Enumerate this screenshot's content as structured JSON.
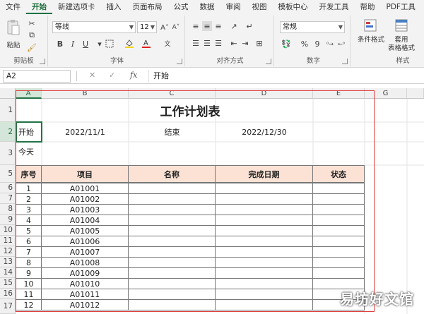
{
  "ribbon_tabs": [
    "文件",
    "开始",
    "新建选项卡",
    "插入",
    "页面布局",
    "公式",
    "数据",
    "审阅",
    "视图",
    "模板中心",
    "开发工具",
    "帮助",
    "PDF工具"
  ],
  "ribbon": {
    "clipboard_label": "剪贴板",
    "paste_label": "粘贴",
    "font_label": "字体",
    "font_name": "等线",
    "font_size": "12",
    "bold": "B",
    "italic": "I",
    "underline": "U",
    "align_label": "对齐方式",
    "number_label": "数字",
    "number_format": "常规",
    "percent": "%",
    "comma": "9",
    "styles_label": "样式",
    "cond_format": "条件格式",
    "table_format_1": "套用",
    "table_format_2": "表格格式"
  },
  "formula_bar": {
    "name_box": "A2",
    "fx": "fx",
    "cancel": "✕",
    "enter": "✓",
    "content": "开始"
  },
  "columns": [
    "A",
    "B",
    "C",
    "D",
    "E",
    "G"
  ],
  "rows": [
    "1",
    "2",
    "3",
    "5",
    "6",
    "7",
    "8",
    "9",
    "10",
    "11",
    "12",
    "13",
    "14",
    "15",
    "16",
    "17"
  ],
  "sheet": {
    "title": "工作计划表",
    "start_label": "开始",
    "start_date": "2022/11/1",
    "end_label": "结束",
    "end_date": "2022/12/30",
    "today_label": "今天",
    "headers": [
      "序号",
      "项目",
      "名称",
      "完成日期",
      "状态"
    ],
    "items": [
      {
        "no": "1",
        "code": "A01001"
      },
      {
        "no": "2",
        "code": "A01002"
      },
      {
        "no": "3",
        "code": "A01003"
      },
      {
        "no": "4",
        "code": "A01004"
      },
      {
        "no": "5",
        "code": "A01005"
      },
      {
        "no": "6",
        "code": "A01006"
      },
      {
        "no": "7",
        "code": "A01007"
      },
      {
        "no": "8",
        "code": "A01008"
      },
      {
        "no": "9",
        "code": "A01009"
      },
      {
        "no": "10",
        "code": "A01010"
      },
      {
        "no": "11",
        "code": "A01011"
      },
      {
        "no": "12",
        "code": "A01012"
      }
    ]
  },
  "watermark": "易坊好文馆",
  "colors": {
    "accent": "#217346",
    "header_fill": "#fbe2d5",
    "highlight_border": "#e0403f"
  }
}
